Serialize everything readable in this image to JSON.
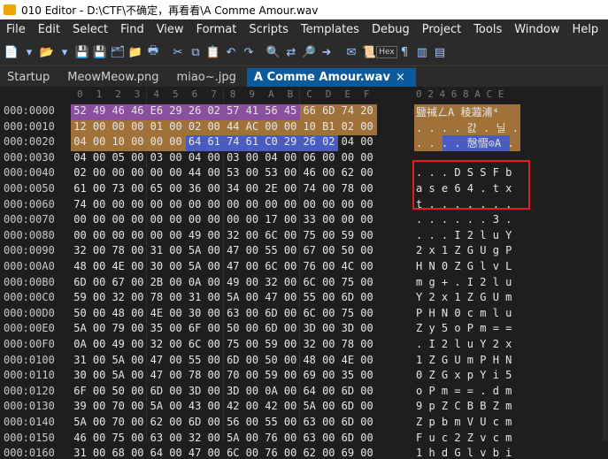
{
  "window": {
    "title": "010 Editor - D:\\CTF\\不确定，再看看\\A Comme Amour.wav"
  },
  "menu": [
    "File",
    "Edit",
    "Select",
    "Find",
    "View",
    "Format",
    "Scripts",
    "Templates",
    "Debug",
    "Project",
    "Tools",
    "Window",
    "Help"
  ],
  "toolbar": {
    "hex_label": "Hex"
  },
  "tabs": [
    {
      "label": "Startup",
      "active": false
    },
    {
      "label": "MeowMeow.png",
      "active": false
    },
    {
      "label": "miao~.jpg",
      "active": false
    },
    {
      "label": "A Comme Amour.wav",
      "active": true
    }
  ],
  "hex_header": [
    "0",
    "1",
    "2",
    "3",
    "4",
    "5",
    "6",
    "7",
    "8",
    "9",
    "A",
    "B",
    "C",
    "D",
    "E",
    "F"
  ],
  "ascii_header": "0 2 4 6 8 A C E",
  "rows": [
    {
      "addr": "000:0000",
      "hex": [
        "52",
        "49",
        "46",
        "46",
        "E6",
        "29",
        "26",
        "02",
        "57",
        "41",
        "56",
        "45",
        "66",
        "6D",
        "74",
        "20"
      ],
      "ascii": [
        "",
        "",
        "",
        "",
        "",
        "",
        "",
        "",
        "",
        "",
        "",
        "",
        "",
        "",
        "",
        ""
      ],
      "ascii_text": "鹽祴ㄥA 稜蕸浦⁴"
    },
    {
      "addr": "000:0010",
      "hex": [
        "12",
        "00",
        "00",
        "00",
        "01",
        "00",
        "02",
        "00",
        "44",
        "AC",
        "00",
        "00",
        "10",
        "B1",
        "02",
        "00"
      ],
      "ascii_text": ". . . . 갌 . 닐 ."
    },
    {
      "addr": "000:0020",
      "hex": [
        "04",
        "00",
        "10",
        "00",
        "00",
        "00",
        "64",
        "61",
        "74",
        "61",
        "C0",
        "29",
        "26",
        "02",
        "04",
        "00"
      ],
      "ascii_text": ". . . . 慤慴⊙A ."
    },
    {
      "addr": "000:0030",
      "hex": [
        "04",
        "00",
        "05",
        "00",
        "03",
        "00",
        "04",
        "00",
        "03",
        "00",
        "04",
        "00",
        "06",
        "00",
        "00",
        "00"
      ],
      "ascii_text": ""
    },
    {
      "addr": "000:0040",
      "hex": [
        "02",
        "00",
        "00",
        "00",
        "00",
        "00",
        "44",
        "00",
        "53",
        "00",
        "53",
        "00",
        "46",
        "00",
        "62",
        "00"
      ],
      "ascii_text": ". . . D S S F b"
    },
    {
      "addr": "000:0050",
      "hex": [
        "61",
        "00",
        "73",
        "00",
        "65",
        "00",
        "36",
        "00",
        "34",
        "00",
        "2E",
        "00",
        "74",
        "00",
        "78",
        "00"
      ],
      "ascii_text": "a s e 6 4 . t x"
    },
    {
      "addr": "000:0060",
      "hex": [
        "74",
        "00",
        "00",
        "00",
        "00",
        "00",
        "00",
        "00",
        "00",
        "00",
        "00",
        "00",
        "00",
        "00",
        "00",
        "00"
      ],
      "ascii_text": "t . . . . . . ."
    },
    {
      "addr": "000:0070",
      "hex": [
        "00",
        "00",
        "00",
        "00",
        "00",
        "00",
        "00",
        "00",
        "00",
        "00",
        "17",
        "00",
        "33",
        "00",
        "00",
        "00"
      ],
      "ascii_text": ". . . . . . 3 ."
    },
    {
      "addr": "000:0080",
      "hex": [
        "00",
        "00",
        "00",
        "00",
        "00",
        "00",
        "49",
        "00",
        "32",
        "00",
        "6C",
        "00",
        "75",
        "00",
        "59",
        "00"
      ],
      "ascii_text": ". . . I 2 l u Y"
    },
    {
      "addr": "000:0090",
      "hex": [
        "32",
        "00",
        "78",
        "00",
        "31",
        "00",
        "5A",
        "00",
        "47",
        "00",
        "55",
        "00",
        "67",
        "00",
        "50",
        "00"
      ],
      "ascii_text": "2 x 1 Z G U g P"
    },
    {
      "addr": "000:00A0",
      "hex": [
        "48",
        "00",
        "4E",
        "00",
        "30",
        "00",
        "5A",
        "00",
        "47",
        "00",
        "6C",
        "00",
        "76",
        "00",
        "4C",
        "00"
      ],
      "ascii_text": "H N 0 Z G l v L"
    },
    {
      "addr": "000:00B0",
      "hex": [
        "6D",
        "00",
        "67",
        "00",
        "2B",
        "00",
        "0A",
        "00",
        "49",
        "00",
        "32",
        "00",
        "6C",
        "00",
        "75",
        "00"
      ],
      "ascii_text": "m g + . I 2 l u"
    },
    {
      "addr": "000:00C0",
      "hex": [
        "59",
        "00",
        "32",
        "00",
        "78",
        "00",
        "31",
        "00",
        "5A",
        "00",
        "47",
        "00",
        "55",
        "00",
        "6D",
        "00"
      ],
      "ascii_text": "Y 2 x 1 Z G U m"
    },
    {
      "addr": "000:00D0",
      "hex": [
        "50",
        "00",
        "48",
        "00",
        "4E",
        "00",
        "30",
        "00",
        "63",
        "00",
        "6D",
        "00",
        "6C",
        "00",
        "75",
        "00"
      ],
      "ascii_text": "P H N 0 c m l u"
    },
    {
      "addr": "000:00E0",
      "hex": [
        "5A",
        "00",
        "79",
        "00",
        "35",
        "00",
        "6F",
        "00",
        "50",
        "00",
        "6D",
        "00",
        "3D",
        "00",
        "3D",
        "00"
      ],
      "ascii_text": "Z y 5 o P m = ="
    },
    {
      "addr": "000:00F0",
      "hex": [
        "0A",
        "00",
        "49",
        "00",
        "32",
        "00",
        "6C",
        "00",
        "75",
        "00",
        "59",
        "00",
        "32",
        "00",
        "78",
        "00"
      ],
      "ascii_text": ". I 2 l u Y 2 x"
    },
    {
      "addr": "000:0100",
      "hex": [
        "31",
        "00",
        "5A",
        "00",
        "47",
        "00",
        "55",
        "00",
        "6D",
        "00",
        "50",
        "00",
        "48",
        "00",
        "4E",
        "00"
      ],
      "ascii_text": "1 Z G U m P H N"
    },
    {
      "addr": "000:0110",
      "hex": [
        "30",
        "00",
        "5A",
        "00",
        "47",
        "00",
        "78",
        "00",
        "70",
        "00",
        "59",
        "00",
        "69",
        "00",
        "35",
        "00"
      ],
      "ascii_text": "0 Z G x p Y i 5"
    },
    {
      "addr": "000:0120",
      "hex": [
        "6F",
        "00",
        "50",
        "00",
        "6D",
        "00",
        "3D",
        "00",
        "3D",
        "00",
        "0A",
        "00",
        "64",
        "00",
        "6D",
        "00"
      ],
      "ascii_text": "o P m = = . d m"
    },
    {
      "addr": "000:0130",
      "hex": [
        "39",
        "00",
        "70",
        "00",
        "5A",
        "00",
        "43",
        "00",
        "42",
        "00",
        "42",
        "00",
        "5A",
        "00",
        "6D",
        "00"
      ],
      "ascii_text": "9 p Z C B B Z m"
    },
    {
      "addr": "000:0140",
      "hex": [
        "5A",
        "00",
        "70",
        "00",
        "62",
        "00",
        "6D",
        "00",
        "56",
        "00",
        "55",
        "00",
        "63",
        "00",
        "6D",
        "00"
      ],
      "ascii_text": "Z p b m V U c m"
    },
    {
      "addr": "000:0150",
      "hex": [
        "46",
        "00",
        "75",
        "00",
        "63",
        "00",
        "32",
        "00",
        "5A",
        "00",
        "76",
        "00",
        "63",
        "00",
        "6D",
        "00"
      ],
      "ascii_text": "F u c 2 Z v c m"
    },
    {
      "addr": "000:0160",
      "hex": [
        "31",
        "00",
        "68",
        "00",
        "64",
        "00",
        "47",
        "00",
        "6C",
        "00",
        "76",
        "00",
        "62",
        "00",
        "69",
        "00"
      ],
      "ascii_text": "1 h d G l v b i"
    }
  ]
}
